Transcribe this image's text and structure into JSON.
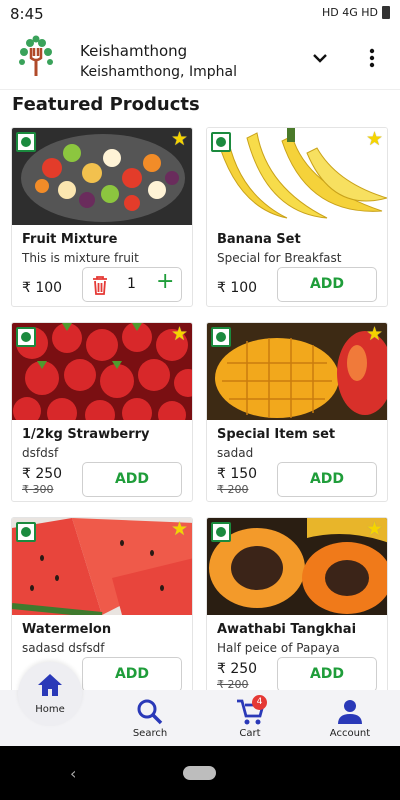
{
  "status_bar": {
    "time": "8:45",
    "indicators": "HD 4G HD"
  },
  "header": {
    "location_title": "Keishamthong",
    "location_subtitle": "Keishamthong, Imphal",
    "logo_icon": "fork-tree-logo",
    "chevron_icon": "chevron-down-icon",
    "menu_icon": "more-vert-icon"
  },
  "section": {
    "title": "Featured Products"
  },
  "products": [
    {
      "name": "Fruit Mixture",
      "desc": "This is mixture fruit",
      "price": "₹ 100",
      "old_price": "",
      "action": "qty",
      "qty": "1",
      "img": "fruit-salad"
    },
    {
      "name": "Banana Set",
      "desc": "Special for Breakfast",
      "price": "₹ 100",
      "old_price": "",
      "action": "add",
      "add_label": "ADD",
      "img": "banana"
    },
    {
      "name": "1/2kg Strawberry",
      "desc": "dsfdsf",
      "price": "₹ 250",
      "old_price": "₹ 300",
      "action": "add",
      "add_label": "ADD",
      "img": "strawberry"
    },
    {
      "name": "Special Item set",
      "desc": "sadad",
      "price": "₹ 150",
      "old_price": "₹ 200",
      "action": "add",
      "add_label": "ADD",
      "img": "mango"
    },
    {
      "name": "Watermelon",
      "desc": "sadasd dsfsdf",
      "price": "",
      "old_price": "",
      "action": "add",
      "add_label": "ADD",
      "img": "watermelon"
    },
    {
      "name": "Awathabi Tangkhai",
      "desc": "Half peice of Papaya",
      "price": "₹ 250",
      "old_price": "₹ 200",
      "action": "add",
      "add_label": "ADD",
      "img": "papaya"
    }
  ],
  "bottom_nav": {
    "home": "Home",
    "search": "Search",
    "cart": "Cart",
    "cart_count": "4",
    "account": "Account",
    "accent": "#2a39b8"
  },
  "colors": {
    "green": "#1f9d3a",
    "trash_red": "#e53935",
    "star": "#f5d400"
  }
}
